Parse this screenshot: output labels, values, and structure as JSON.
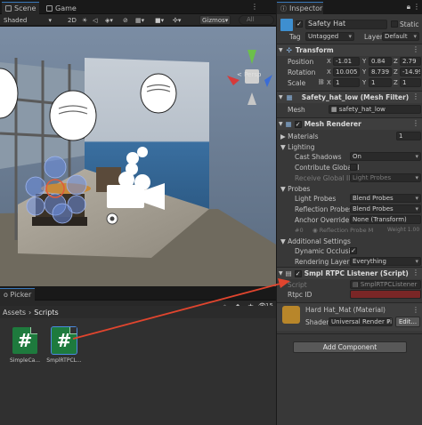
{
  "scene_tabs": {
    "scene": "Scene",
    "game": "Game"
  },
  "scene_toolbar": {
    "shading_mode": "Shaded",
    "mode_2d": "2D",
    "gizmos": "Gizmos",
    "search_placeholder": "All"
  },
  "viewport": {
    "gizmo_label": "< Persp"
  },
  "project": {
    "tab_label": "o Picker",
    "count": "15",
    "breadcrumb": [
      "Assets",
      "Scripts"
    ],
    "assets": [
      {
        "label": "SimpleCa...",
        "icon": "csharp-script-icon",
        "glyph": "#"
      },
      {
        "label": "SmplRTPCL...",
        "icon": "csharp-script-icon",
        "glyph": "#"
      }
    ]
  },
  "inspector": {
    "tab_label": "Inspector",
    "object": {
      "name": "Safety Hat",
      "static_label": "Static",
      "tag_label": "Tag",
      "tag": "Untagged",
      "layer_label": "Layer",
      "layer": "Default"
    },
    "transform": {
      "title": "Transform",
      "position_label": "Position",
      "position": {
        "x": "-1.01",
        "y": "0.84",
        "z": "2.79"
      },
      "rotation_label": "Rotation",
      "rotation": {
        "x": "10.005",
        "y": "8.739",
        "z": "-14.99"
      },
      "scale_label": "Scale",
      "scale": {
        "x": "1",
        "y": "1",
        "z": "1"
      },
      "axes": {
        "x": "X",
        "y": "Y",
        "z": "Z"
      }
    },
    "mesh_filter": {
      "title": "Safety_hat_low (Mesh Filter)",
      "mesh_label": "Mesh",
      "mesh_value": "safety_hat_low"
    },
    "mesh_renderer": {
      "title": "Mesh Renderer",
      "materials_label": "Materials",
      "materials_count": "1",
      "lighting_label": "Lighting",
      "cast_shadows_label": "Cast Shadows",
      "cast_shadows": "On",
      "contribute_gi_label": "Contribute Global Il",
      "receive_gi_label": "Receive Global Illu",
      "receive_gi": "Light Probes",
      "probes_label": "Probes",
      "light_probes_label": "Light Probes",
      "light_probes": "Blend Probes",
      "reflection_probes_label": "Reflection Probes",
      "reflection_probes": "Blend Probes",
      "anchor_override_label": "Anchor Override",
      "anchor_override": "None (Transform)",
      "probe_row_prefix": "#0",
      "probe_row_value": "Reflection Probe M",
      "probe_row_weight": "Weight 1.00",
      "additional_label": "Additional Settings",
      "dynamic_occlusion_label": "Dynamic Occlusio",
      "rendering_layer_label": "Rendering Layer M",
      "rendering_layer": "Everything"
    },
    "listener": {
      "title": "Smpl RTPC Listener (Script)",
      "script_label": "Script",
      "script_value": "SmplRTPCListener",
      "rtpc_label": "Rtpc ID",
      "rtpc_value": ""
    },
    "material": {
      "title": "Hard Hat_Mat (Material)",
      "shader_label": "Shader",
      "shader_value": "Universal Render Pi",
      "edit_label": "Edit..."
    },
    "add_component": "Add Component"
  },
  "colors": {
    "accent_blue": "#3a79bb",
    "error_red": "#7a2626",
    "arrow_red": "#e0452e",
    "script_green": "#1e7a3d"
  }
}
